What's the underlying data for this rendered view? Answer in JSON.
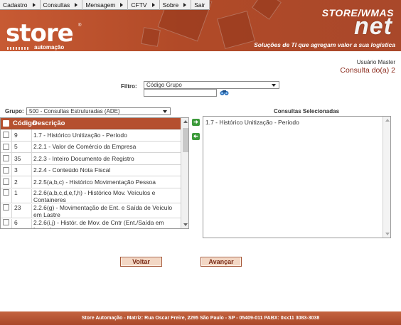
{
  "menu": {
    "items": [
      {
        "label": "Cadastro",
        "has_arrow": true
      },
      {
        "label": "Consultas",
        "has_arrow": true
      },
      {
        "label": "Mensagem",
        "has_arrow": true
      },
      {
        "label": "CFTV",
        "has_arrow": true
      },
      {
        "label": "Sobre",
        "has_arrow": true
      },
      {
        "label": "Sair",
        "has_arrow": false
      }
    ]
  },
  "header": {
    "logo_text": "store",
    "logo_registered": "®",
    "logo_sub": "automação",
    "brand_top": "STORE/WMAS",
    "brand_net": "net",
    "tagline": "Soluções de TI que agregam valor a sua logística",
    "brand_color": "#b84f2c"
  },
  "user": {
    "name": "Usuário Master",
    "page_title": "Consulta do(a) 2"
  },
  "filter": {
    "label": "Filtro:",
    "selected": "Código Grupo",
    "input_value": ""
  },
  "group": {
    "label": "Grupo:",
    "selected": "500 - Consultas Estruturadas (ADE)"
  },
  "list": {
    "headers": {
      "code": "Código",
      "desc": "Descrição"
    },
    "rows": [
      {
        "code": "9",
        "desc": "1.7 - Histórico Unitização - Período"
      },
      {
        "code": "5",
        "desc": "2.2.1 - Valor de Comércio da Empresa"
      },
      {
        "code": "35",
        "desc": "2.2.3 - Inteiro Documento de Registro"
      },
      {
        "code": "3",
        "desc": "2.2.4 - Conteúdo Nota Fiscal"
      },
      {
        "code": "2",
        "desc": "2.2.5(a,b,c) - Histórico Movimentação Pessoa"
      },
      {
        "code": "1",
        "desc": "2.2.6(a,b,c,d,e,f,h) - Histórico Mov. Veículos e Containeres"
      },
      {
        "code": "23",
        "desc": "2.2.6(g) - Movimentação de Ent. e Saída de Veículo em Lastre"
      },
      {
        "code": "6",
        "desc": "2.2.6(i,j) - Histór. de Mov. de Cntr (Ent./Saída em Lastre)"
      }
    ]
  },
  "selected": {
    "title": "Consultas Selecionadas",
    "items": [
      "1.7 - Histórico Unitização - Período"
    ]
  },
  "buttons": {
    "back": "Voltar",
    "next": "Avançar"
  },
  "footer": {
    "text": "Store Automação - Matriz: Rua Oscar Freire, 2295 São Paulo - SP - 05409-011 PABX: 0xx11 3083-3038"
  }
}
